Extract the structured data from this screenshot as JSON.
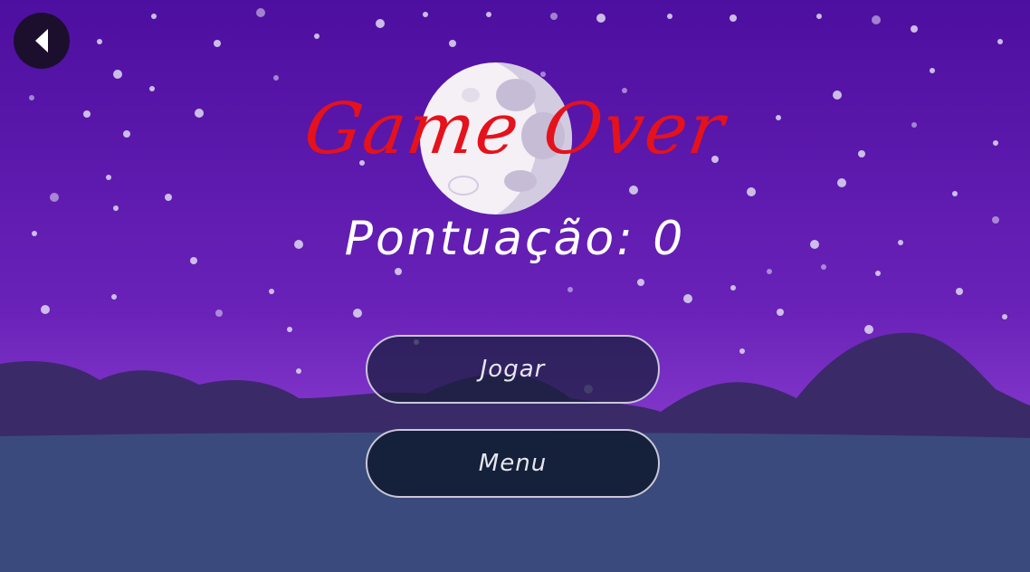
{
  "game": {
    "title": "Game Over",
    "score_text": "Pontuação: 0"
  },
  "buttons": {
    "play_label": "Jogar",
    "menu_label": "Menu"
  },
  "colors": {
    "sky_top": "#4d0fa0",
    "sky_bottom": "#8a3ed0",
    "hills": "#3a2a68",
    "water": "#3b4a7c",
    "title_red": "#e5121c",
    "moon": "#f4f0f6",
    "moon_shadow": "#d3cbe0"
  },
  "icons": {
    "back": "back-arrow-icon",
    "moon": "full-moon"
  }
}
